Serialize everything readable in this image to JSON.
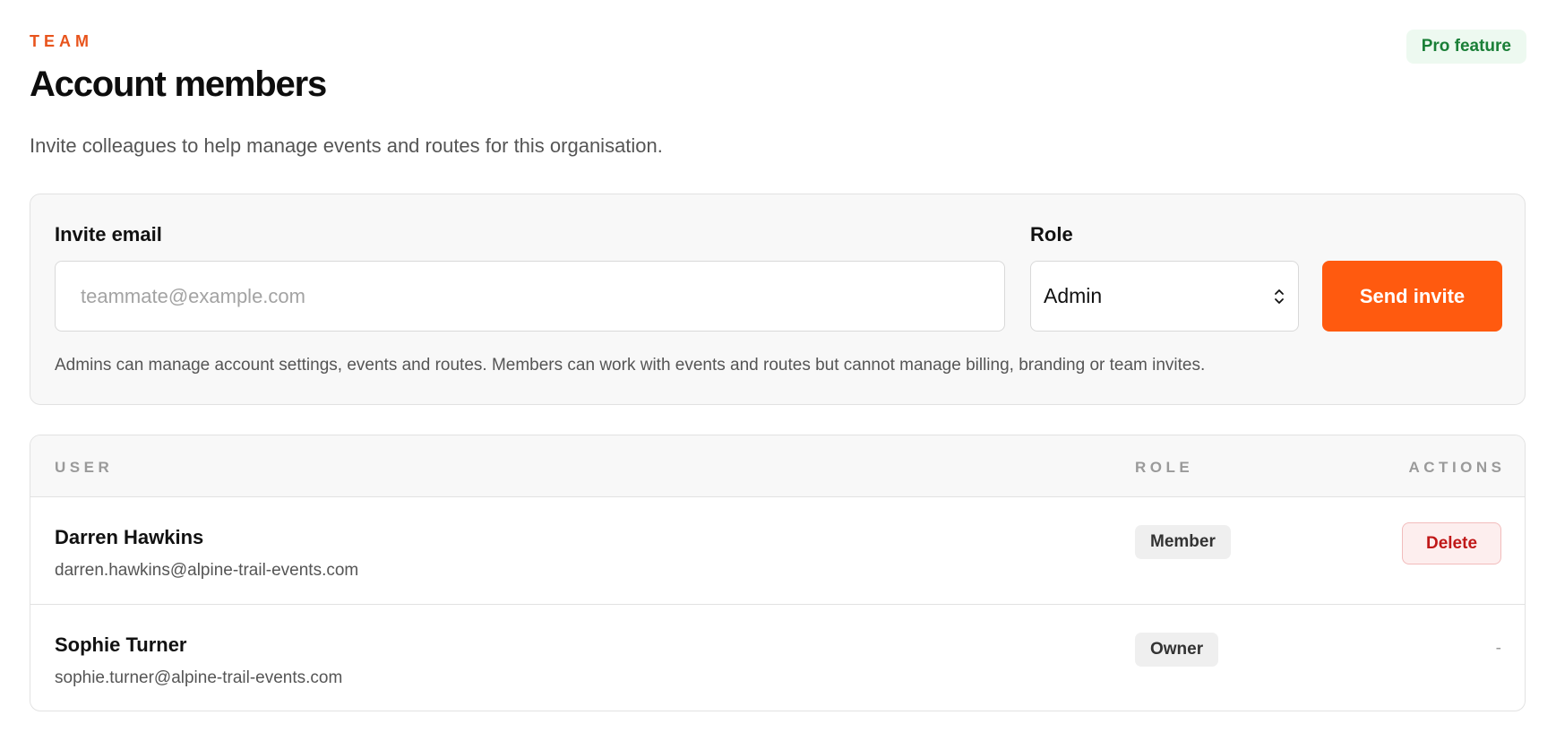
{
  "header": {
    "eyebrow": "TEAM",
    "title": "Account members",
    "subtitle": "Invite colleagues to help manage events and routes for this organisation.",
    "badge": "Pro feature"
  },
  "invite": {
    "email_label": "Invite email",
    "email_placeholder": "teammate@example.com",
    "email_value": "",
    "role_label": "Role",
    "role_selected": "Admin",
    "send_label": "Send invite",
    "helper": "Admins can manage account settings, events and routes. Members can work with events and routes but cannot manage billing, branding or team invites."
  },
  "table": {
    "columns": {
      "user": "USER",
      "role": "ROLE",
      "actions": "ACTIONS"
    },
    "rows": [
      {
        "name": "Darren Hawkins",
        "email": "darren.hawkins@alpine-trail-events.com",
        "role": "Member",
        "action": "Delete"
      },
      {
        "name": "Sophie Turner",
        "email": "sophie.turner@alpine-trail-events.com",
        "role": "Owner",
        "action": "-"
      }
    ]
  },
  "colors": {
    "accent": "#ff5a0f",
    "eyebrow": "#e8541c",
    "pro_badge_text": "#1a7f37",
    "pro_badge_bg": "#edf9f0",
    "danger": "#c01818"
  },
  "icons": {
    "role_select": "chevron-up-down-icon"
  }
}
